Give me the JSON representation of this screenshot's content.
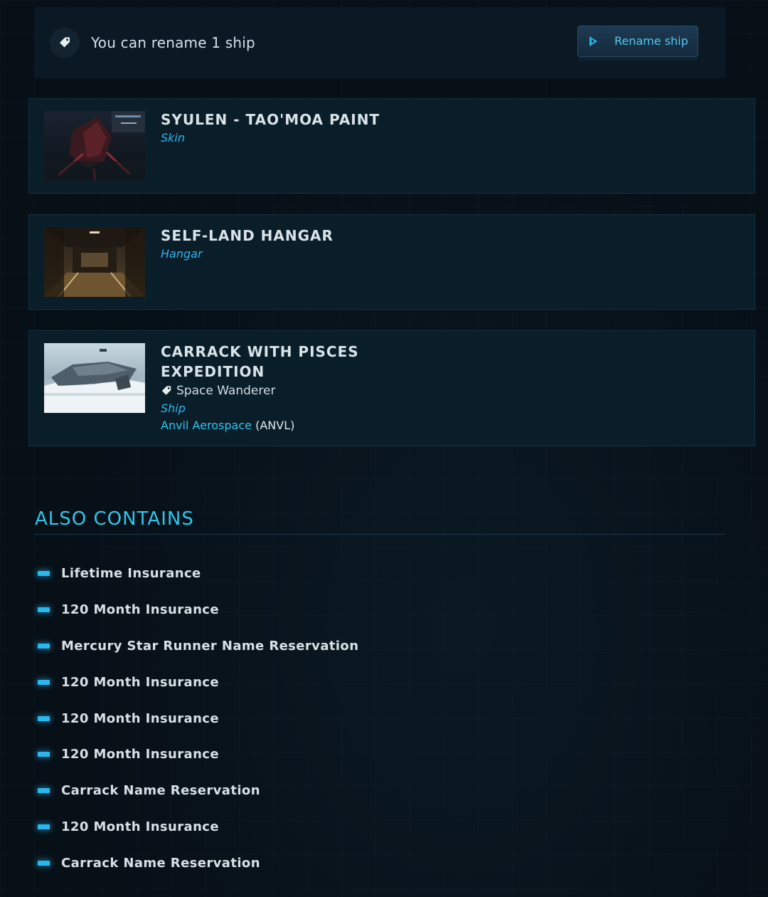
{
  "rename": {
    "text": "You can rename 1 ship",
    "button_label": "Rename ship"
  },
  "items": [
    {
      "title": "SYULEN - TAO'MOA PAINT",
      "type": "Skin"
    },
    {
      "title": "SELF-LAND HANGAR",
      "type": "Hangar"
    },
    {
      "title_line1": "CARRACK WITH PISCES",
      "title_line2": "EXPEDITION",
      "tagline": "Space Wanderer",
      "type": "Ship",
      "manufacturer": "Anvil Aerospace",
      "manufacturer_code": "(ANVL)"
    }
  ],
  "also_contains": {
    "heading": "ALSO CONTAINS",
    "items": [
      "Lifetime Insurance",
      "120 Month Insurance",
      "Mercury Star Runner Name Reservation",
      "120 Month Insurance",
      "120 Month Insurance",
      "120 Month Insurance",
      "Carrack Name Reservation",
      "120 Month Insurance",
      "Carrack Name Reservation"
    ]
  },
  "colors": {
    "accent": "#2ec6ea",
    "background": "#070f17",
    "card": "#0a1e2a"
  }
}
